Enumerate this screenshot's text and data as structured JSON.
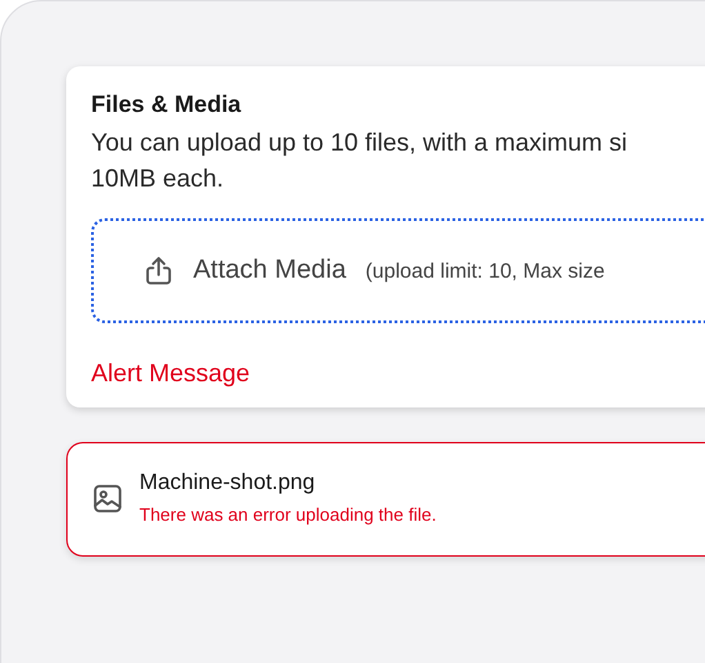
{
  "files_card": {
    "title": "Files & Media",
    "description": "You can upload up to 10 files, with a maximum si\n10MB each.",
    "dropzone": {
      "label": "Attach Media",
      "hint": "(upload limit: 10, Max size"
    },
    "alert": "Alert Message"
  },
  "uploads": [
    {
      "name": "Machine-shot.png",
      "failed": true,
      "message": "There was an error uploading the file."
    }
  ]
}
